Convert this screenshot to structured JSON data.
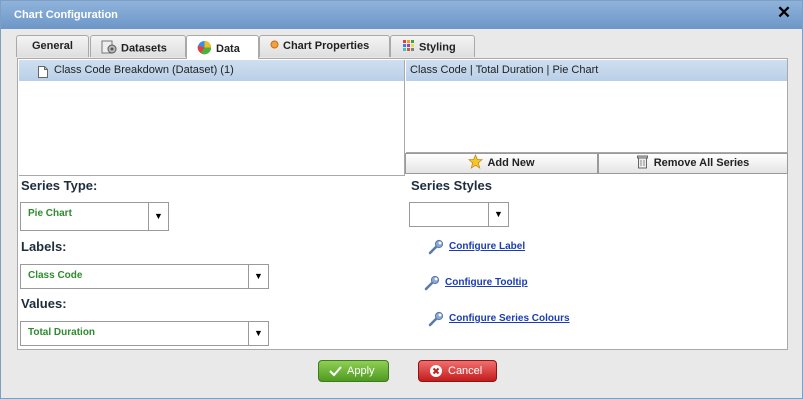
{
  "dialog": {
    "title": "Chart Configuration"
  },
  "tabs": [
    {
      "label": "General",
      "icon": "none",
      "active": false
    },
    {
      "label": "Datasets",
      "icon": "dataset-icon",
      "active": false
    },
    {
      "label": "Data",
      "icon": "pie-chart-icon",
      "active": true
    },
    {
      "label": "Chart Properties",
      "icon": "dot-icon",
      "active": false
    },
    {
      "label": "Styling",
      "icon": "grid-colors-icon",
      "active": false
    }
  ],
  "datasets_list": {
    "header": "Class Code Breakdown (Dataset) (1)"
  },
  "series_list": {
    "header": "Class Code | Total Duration | Pie Chart"
  },
  "buttons": {
    "add_new": "Add New",
    "remove_all": "Remove All Series"
  },
  "series_type": {
    "label": "Series Type:",
    "value": "Pie Chart"
  },
  "labels_field": {
    "label": "Labels:",
    "value": "Class Code"
  },
  "values_field": {
    "label": "Values:",
    "value": "Total Duration"
  },
  "series_styles": {
    "label": "Series Styles",
    "value": "",
    "links": [
      "Configure Label",
      "Configure Tooltip",
      "Configure Series Colours"
    ]
  },
  "footer": {
    "apply": "Apply",
    "cancel": "Cancel"
  }
}
